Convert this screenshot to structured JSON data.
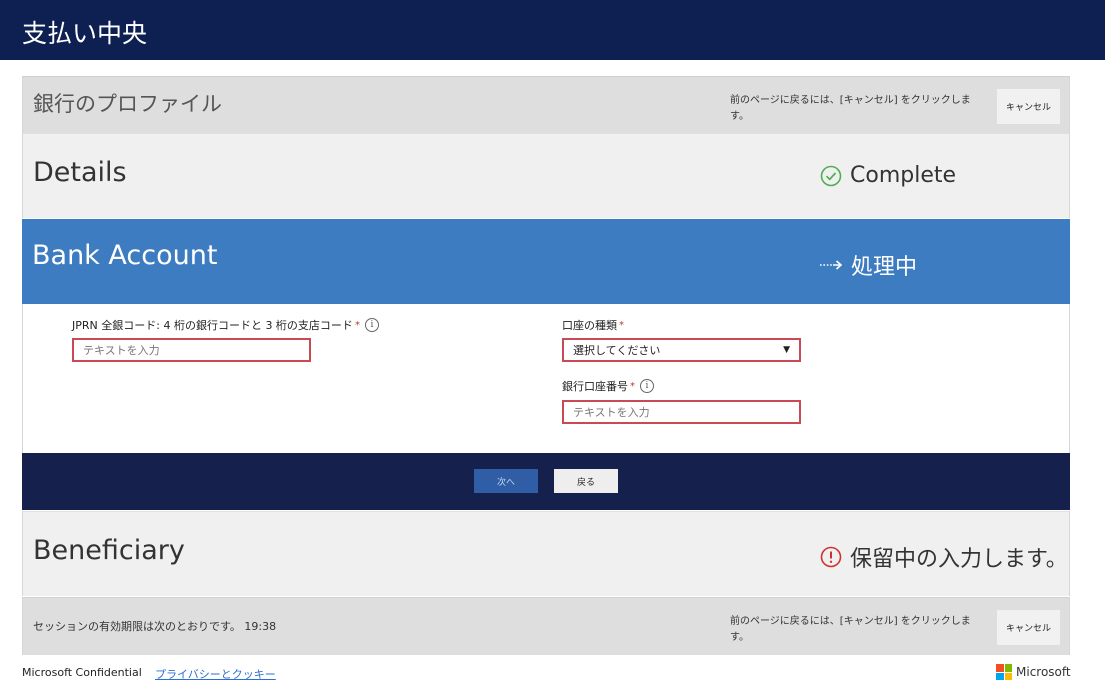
{
  "header": {
    "title": "支払い中央"
  },
  "profile": {
    "title": "銀行のプロファイル",
    "hint": "前のページに戻るには、[キャンセル] をクリックします。",
    "cancel_label": "キャンセル"
  },
  "steps": {
    "details": {
      "title": "Details",
      "status": "Complete",
      "icon": "check-circle-icon"
    },
    "bank": {
      "title": "Bank Account",
      "status": "処理中",
      "icon": "dotted-arrow-right-icon"
    },
    "beneficiary": {
      "title": "Beneficiary",
      "status": "保留中の入力します。",
      "icon": "alert-circle-icon"
    }
  },
  "form": {
    "jprn": {
      "label": "JPRN 全銀コード: 4 桁の銀行コードと 3 桁の支店コード",
      "required_mark": "*",
      "placeholder": "テキストを入力"
    },
    "account_type": {
      "label": "口座の種類",
      "required_mark": "*",
      "selected": "選択してください"
    },
    "account_number": {
      "label": "銀行口座番号",
      "required_mark": "*",
      "placeholder": "テキストを入力"
    }
  },
  "nav": {
    "next_label": "次へ",
    "back_label": "戻る"
  },
  "footer": {
    "session": "セッションの有効期限は次のとおりです。 19:38",
    "hint": "前のページに戻るには、[キャンセル] をクリックします。",
    "cancel_label": "キャンセル"
  },
  "bottom": {
    "confidential": "Microsoft Confidential",
    "privacy_link": "プライバシーとクッキー",
    "brand": "Microsoft"
  },
  "colors": {
    "header_bg": "#0e1f52",
    "active_step_bg": "#3d7cc0",
    "nav_bar_bg": "#16204c",
    "error_border": "#c94a55",
    "complete_green": "#4caf50",
    "alert_red": "#d32f2f"
  }
}
